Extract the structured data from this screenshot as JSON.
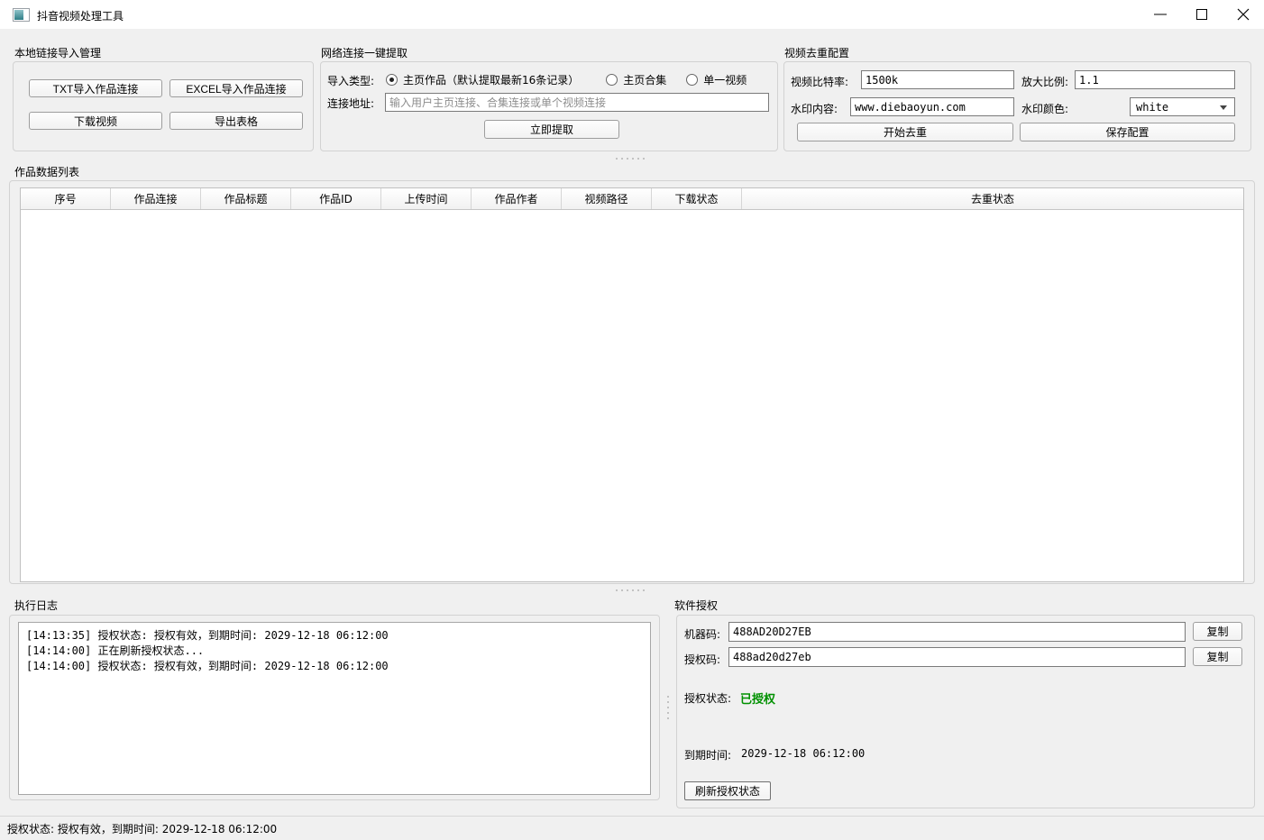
{
  "window": {
    "title": "抖音视频处理工具",
    "icons": {
      "app": "app-window",
      "minimize": "minimize-line",
      "maximize": "maximize-square",
      "close": "close-x"
    }
  },
  "local_import": {
    "title": "本地链接导入管理",
    "buttons": [
      "TXT导入作品连接",
      "EXCEL导入作品连接",
      "下载视频",
      "导出表格"
    ]
  },
  "network_extract": {
    "title": "网络连接一键提取",
    "import_type_label": "导入类型:",
    "radios": [
      {
        "label": "主页作品（默认提取最新16条记录）",
        "selected": true
      },
      {
        "label": "主页合集",
        "selected": false
      },
      {
        "label": "单一视频",
        "selected": false
      }
    ],
    "address_label": "连接地址:",
    "address_placeholder": "输入用户主页连接、合集连接或单个视频连接",
    "extract_button": "立即提取"
  },
  "dedup_config": {
    "title": "视频去重配置",
    "bitrate_label": "视频比特率:",
    "bitrate_value": "1500k",
    "scale_label": "放大比例:",
    "scale_value": "1.1",
    "watermark_label": "水印内容:",
    "watermark_value": "www.diebaoyun.com",
    "color_label": "水印颜色:",
    "color_value": "white",
    "start_button": "开始去重",
    "save_button": "保存配置"
  },
  "works_table": {
    "title": "作品数据列表",
    "columns": [
      "序号",
      "作品连接",
      "作品标题",
      "作品ID",
      "上传时间",
      "作品作者",
      "视频路径",
      "下载状态",
      "去重状态"
    ],
    "rows": []
  },
  "log": {
    "title": "执行日志",
    "lines": [
      "[14:13:35] 授权状态: 授权有效，到期时间: 2029-12-18 06:12:00",
      "[14:14:00] 正在刷新授权状态...",
      "[14:14:00] 授权状态: 授权有效，到期时间: 2029-12-18 06:12:00"
    ]
  },
  "license": {
    "title": "软件授权",
    "machine_code_label": "机器码:",
    "machine_code": "488AD20D27EB",
    "license_code_label": "授权码:",
    "license_code": "488ad20d27eb",
    "copy_button": "复制",
    "status_label": "授权状态:",
    "status_value": "已授权",
    "status_color": "#009100",
    "expire_label": "到期时间:",
    "expire_value": "2029-12-18 06:12:00",
    "refresh_button": "刷新授权状态"
  },
  "status_bar": {
    "text": "授权状态: 授权有效，到期时间: 2029-12-18 06:12:00"
  }
}
